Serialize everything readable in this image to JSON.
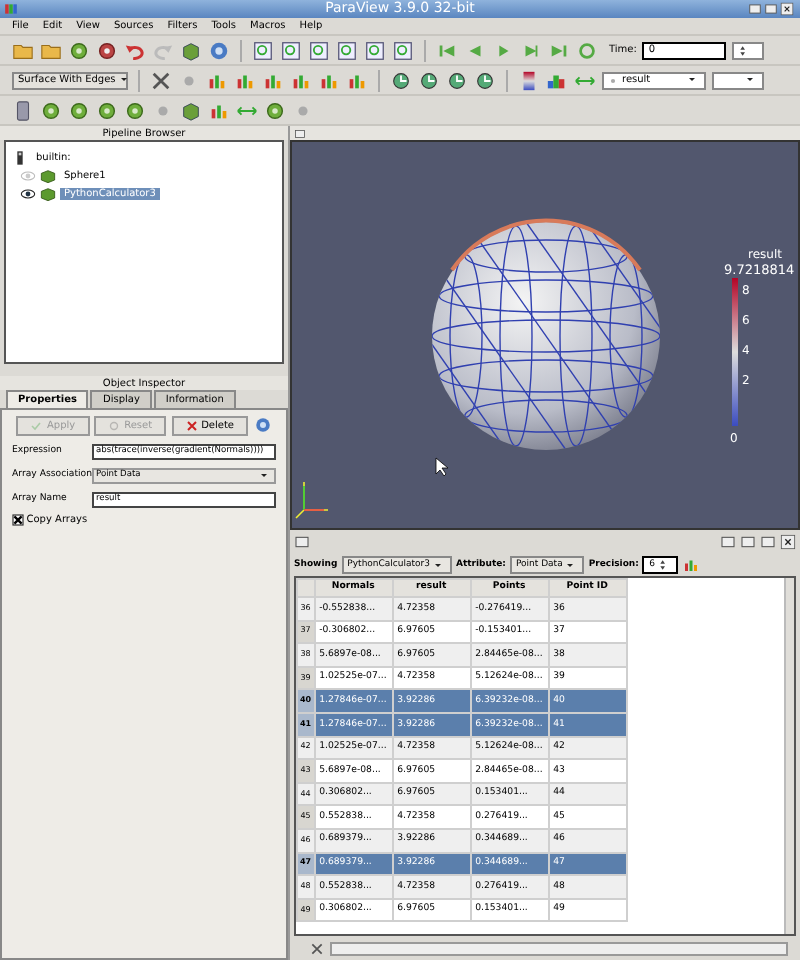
{
  "window": {
    "title": "ParaView 3.9.0 32-bit"
  },
  "menu": [
    "File",
    "Edit",
    "View",
    "Sources",
    "Filters",
    "Tools",
    "Macros",
    "Help"
  ],
  "toolbar": {
    "time_label": "Time:",
    "time_value": "0",
    "representation": "Surface With Edges",
    "color_by": "result"
  },
  "pipeline_browser": {
    "title": "Pipeline Browser",
    "items": [
      {
        "label": "builtin:",
        "kind": "server",
        "selected": false,
        "children": [
          {
            "label": "Sphere1",
            "kind": "source",
            "visible": false,
            "selected": false
          },
          {
            "label": "PythonCalculator3",
            "kind": "source",
            "visible": true,
            "selected": true
          }
        ]
      }
    ]
  },
  "object_inspector": {
    "title": "Object Inspector",
    "tabs": [
      {
        "label": "Properties",
        "selected": true
      },
      {
        "label": "Display",
        "selected": false
      },
      {
        "label": "Information",
        "selected": false
      }
    ],
    "buttons": [
      {
        "label": "Apply",
        "kind": "apply",
        "disabled": true
      },
      {
        "label": "Reset",
        "kind": "reset",
        "disabled": true
      },
      {
        "label": "Delete",
        "kind": "delete",
        "disabled": false
      }
    ],
    "fields": [
      {
        "label": "Expression",
        "kind": "text",
        "value": "abs(trace(inverse(gradient(Normals))))"
      },
      {
        "label": "Array Association",
        "kind": "select",
        "value": "Point Data"
      },
      {
        "label": "Array Name",
        "kind": "text",
        "value": "result"
      }
    ],
    "copy_arrays": {
      "label": "Copy Arrays",
      "checked": true
    }
  },
  "view": {
    "legend": {
      "title": "result",
      "max": "9.7218814",
      "ticks": [
        "8",
        "6",
        "4",
        "2",
        "0"
      ]
    }
  },
  "spreadsheet": {
    "showing_label": "Showing",
    "source": "PythonCalculator3",
    "attribute_label": "Attribute:",
    "attribute": "Point Data",
    "precision_label": "Precision:",
    "precision": "6",
    "columns": [
      "Normals",
      "result",
      "Points",
      "Point ID"
    ],
    "rows": [
      {
        "index": "36",
        "cells": [
          "-0.552838...",
          "4.72358",
          "-0.276419...",
          "36"
        ],
        "selected": false
      },
      {
        "index": "37",
        "cells": [
          "-0.306802...",
          "6.97605",
          "-0.153401...",
          "37"
        ],
        "selected": false
      },
      {
        "index": "38",
        "cells": [
          "5.6897e-08...",
          "6.97605",
          "2.84465e-08...",
          "38"
        ],
        "selected": false
      },
      {
        "index": "39",
        "cells": [
          "1.02525e-07...",
          "4.72358",
          "5.12624e-08...",
          "39"
        ],
        "selected": false
      },
      {
        "index": "40",
        "cells": [
          "1.27846e-07...",
          "3.92286",
          "6.39232e-08...",
          "40"
        ],
        "selected": true
      },
      {
        "index": "41",
        "cells": [
          "1.27846e-07...",
          "3.92286",
          "6.39232e-08...",
          "41"
        ],
        "selected": true
      },
      {
        "index": "42",
        "cells": [
          "1.02525e-07...",
          "4.72358",
          "5.12624e-08...",
          "42"
        ],
        "selected": false
      },
      {
        "index": "43",
        "cells": [
          "5.6897e-08...",
          "6.97605",
          "2.84465e-08...",
          "43"
        ],
        "selected": false
      },
      {
        "index": "44",
        "cells": [
          "0.306802...",
          "6.97605",
          "0.153401...",
          "44"
        ],
        "selected": false
      },
      {
        "index": "45",
        "cells": [
          "0.552838...",
          "4.72358",
          "0.276419...",
          "45"
        ],
        "selected": false
      },
      {
        "index": "46",
        "cells": [
          "0.689379...",
          "3.92286",
          "0.344689...",
          "46"
        ],
        "selected": false
      },
      {
        "index": "47",
        "cells": [
          "0.689379...",
          "3.92286",
          "0.344689...",
          "47"
        ],
        "selected": true
      },
      {
        "index": "48",
        "cells": [
          "0.552838...",
          "4.72358",
          "0.276419...",
          "48"
        ],
        "selected": false
      },
      {
        "index": "49",
        "cells": [
          "0.306802...",
          "6.97605",
          "0.153401...",
          "49"
        ],
        "selected": false
      }
    ]
  }
}
